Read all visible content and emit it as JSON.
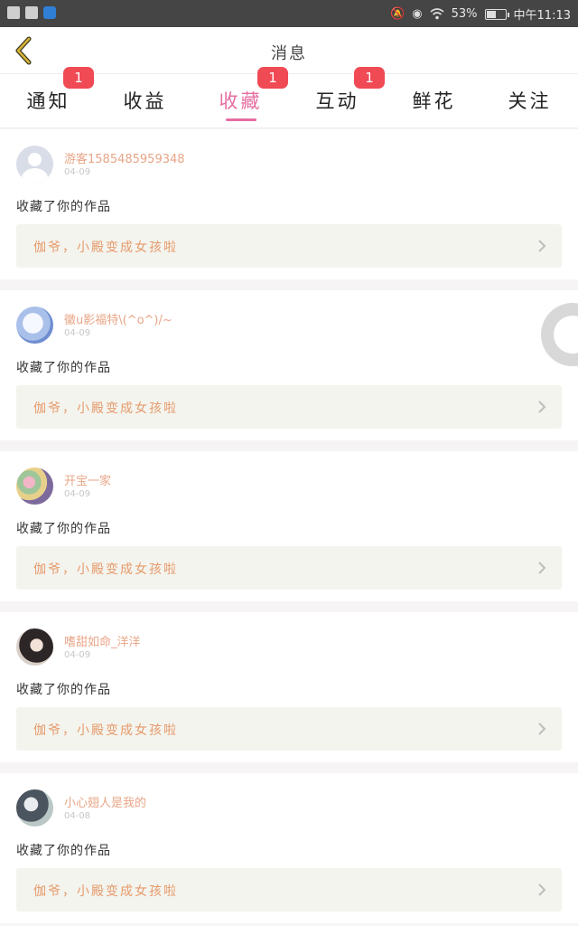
{
  "status_bar": {
    "time": "中午11:13",
    "battery": "53%",
    "battery_level": 0.53,
    "left_icons": [
      "android-icon",
      "android-icon",
      "app-icon"
    ],
    "right_icons": [
      "mute-icon",
      "eye-icon",
      "wifi-icon",
      "battery-icon"
    ]
  },
  "header": {
    "title": "消息",
    "back_icon": "chevron-left-icon"
  },
  "tabs": [
    {
      "label": "通知",
      "badge": "1",
      "active": false
    },
    {
      "label": "收益",
      "badge": "",
      "active": false
    },
    {
      "label": "收藏",
      "badge": "1",
      "active": true
    },
    {
      "label": "互动",
      "badge": "1",
      "active": false
    },
    {
      "label": "鲜花",
      "badge": "",
      "active": false
    },
    {
      "label": "关注",
      "badge": "",
      "active": false
    }
  ],
  "messages": [
    {
      "user": "游客1585485959348",
      "date": "04-09",
      "action": "收藏了你的作品",
      "work": "伽爷，小殿变成女孩啦"
    },
    {
      "user": "黴u影福特\\(^o^)/~",
      "date": "04-09",
      "action": "收藏了你的作品",
      "work": "伽爷，小殿变成女孩啦"
    },
    {
      "user": "开宝一家",
      "date": "04-09",
      "action": "收藏了你的作品",
      "work": "伽爷，小殿变成女孩啦"
    },
    {
      "user": "嗜甜如命_洋洋",
      "date": "04-09",
      "action": "收藏了你的作品",
      "work": "伽爷，小殿变成女孩啦"
    },
    {
      "user": "小心翅人是我的",
      "date": "04-08",
      "action": "收藏了你的作品",
      "work": "伽爷，小殿变成女孩啦"
    }
  ],
  "colors": {
    "accent": "#e56ea1",
    "badge": "#f04a55",
    "username": "#e8a587",
    "work_title": "#e59a6b",
    "back_icon": "#d9b43a"
  }
}
